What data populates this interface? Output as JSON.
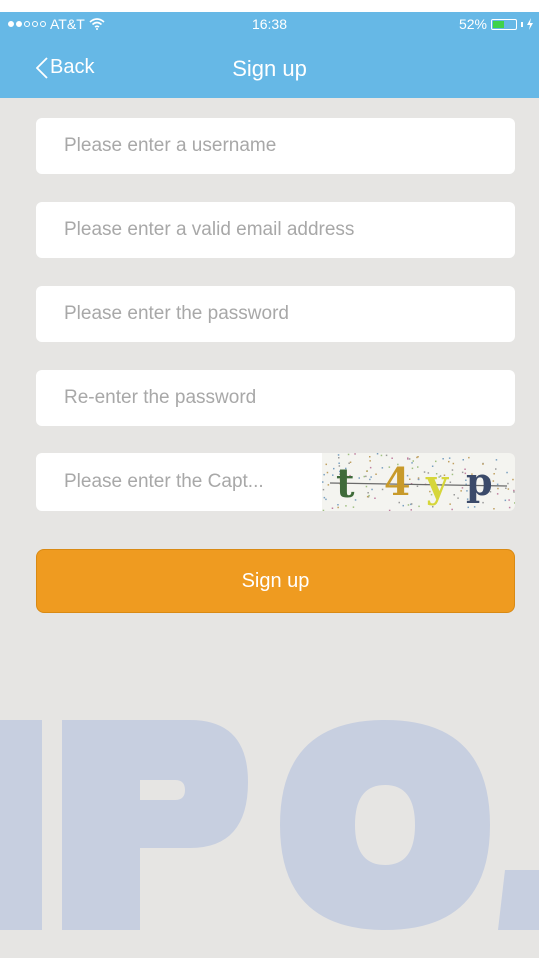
{
  "status_bar": {
    "carrier": "AT&T",
    "time": "16:38",
    "battery_percent": "52%",
    "battery_level": 0.52,
    "battery_color": "#3fd24a"
  },
  "nav": {
    "back_label": "Back",
    "title": "Sign up"
  },
  "form": {
    "username_placeholder": "Please enter a username",
    "email_placeholder": "Please enter a valid email address",
    "password_placeholder": "Please enter the password",
    "confirm_password_placeholder": "Re-enter the password",
    "captcha_placeholder": "Please enter the Capt...",
    "captcha_chars": [
      "t",
      "4",
      "y",
      "p"
    ],
    "captcha_colors": [
      "#3f6b3a",
      "#c89a2a",
      "#d6d63a",
      "#3b4a6a"
    ]
  },
  "signup_button": {
    "label": "Sign up",
    "color": "#ef9b20"
  },
  "watermark": {
    "text": "IPO.",
    "color": "#c7cfe0"
  },
  "colors": {
    "header": "#66b8e6",
    "background": "#e6e5e3"
  }
}
